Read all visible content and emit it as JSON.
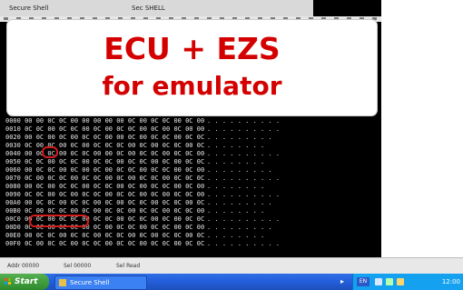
{
  "window": {
    "title_left": "Secure Shell",
    "title_mid": "Sec SHELL"
  },
  "banner": {
    "line1": "ECU + EZS",
    "line2": "for emulator"
  },
  "hex_rows": [
    {
      "addr": "0000",
      "bytes": "00 00 0C 0C 00 00 00 00 00 0C 00 0C 0C 00 0C 00",
      "ascii": ". . . . . . . . . ."
    },
    {
      "addr": "0010",
      "bytes": "0C 0C 00 0C 0C 00 0C 00 0C 0C 00 0C 00 0C 00 00",
      "ascii": ". . . . . . . . . ."
    },
    {
      "addr": "0020",
      "bytes": "00 0C 00 0C 00 0C 0C 00 00 0C 00 0C 0C 00 0C 0C",
      "ascii": ". . . . . . . . ."
    },
    {
      "addr": "0030",
      "bytes": "0C 00 0C 00 0C 00 0C 0C 0C 00 0C 00 0C 0C 00 0C",
      "ascii": ". . . . . . . ."
    },
    {
      "addr": "0040",
      "bytes": "00 0C 0C 00 0C 0C 00 00 0C 00 0C 0C 00 0C 0C 00",
      "ascii": ". . . . . . . . . ."
    },
    {
      "addr": "0050",
      "bytes": "0C 0C 00 0C 0C 00 0C 0C 00 0C 0C 00 0C 00 0C 0C",
      "ascii": ". . . . . . . ."
    },
    {
      "addr": "0060",
      "bytes": "00 0C 0C 00 0C 00 0C 00 0C 0C 00 0C 0C 00 0C 00",
      "ascii": ". . . . . . . . ."
    },
    {
      "addr": "0070",
      "bytes": "0C 00 0C 0C 00 0C 0C 00 0C 00 0C 0C 00 0C 0C 0C",
      "ascii": ". . . . . . . . . ."
    },
    {
      "addr": "0080",
      "bytes": "00 0C 00 0C 0C 00 0C 0C 00 0C 00 0C 0C 00 0C 00",
      "ascii": ". . . . . . . ."
    },
    {
      "addr": "0090",
      "bytes": "0C 0C 00 0C 00 0C 0C 00 0C 0C 00 0C 00 0C 0C 00",
      "ascii": ". . . . . . . . . ."
    },
    {
      "addr": "00A0",
      "bytes": "00 0C 0C 00 0C 0C 00 0C 00 0C 0C 00 0C 0C 00 0C",
      "ascii": ". . . . . . . . ."
    },
    {
      "addr": "00B0",
      "bytes": "0C 00 0C 0C 00 0C 00 0C 0C 00 0C 0C 00 0C 0C 00",
      "ascii": ". . . . . . . ."
    },
    {
      "addr": "00C0",
      "bytes": "00 0C 00 0C 0C 00 0C 0C 00 0C 0C 00 0C 00 0C 0C",
      "ascii": ". . . . . . . . . ."
    },
    {
      "addr": "00D0",
      "bytes": "0C 0C 00 0C 0C 00 0C 00 0C 0C 00 0C 0C 00 0C 00",
      "ascii": ". . . . . . . . ."
    },
    {
      "addr": "00E0",
      "bytes": "00 0C 0C 00 0C 0C 00 0C 0C 00 0C 00 0C 0C 00 0C",
      "ascii": ". . . . . . . ."
    },
    {
      "addr": "00F0",
      "bytes": "0C 00 0C 0C 00 0C 0C 00 0C 0C 00 0C 0C 00 0C 0C",
      "ascii": ". . . . . . . . . ."
    }
  ],
  "status": {
    "left": "Addr 00000",
    "mid": "Sel 00000",
    "right": "Sel Read"
  },
  "taskbar": {
    "start_label": "Start",
    "task_item": "Secure Shell",
    "lang": "EN",
    "clock": "12:00"
  },
  "colors": {
    "banner_text": "#d40000",
    "highlight_ring": "#d21d1d",
    "taskbar": "#245edb",
    "start_button": "#3c9a38",
    "tray": "#13a1f0"
  },
  "icons": [
    "windows-logo-icon",
    "app-icon",
    "tray-arrow-icon",
    "speaker-icon",
    "network-icon",
    "shield-icon"
  ]
}
